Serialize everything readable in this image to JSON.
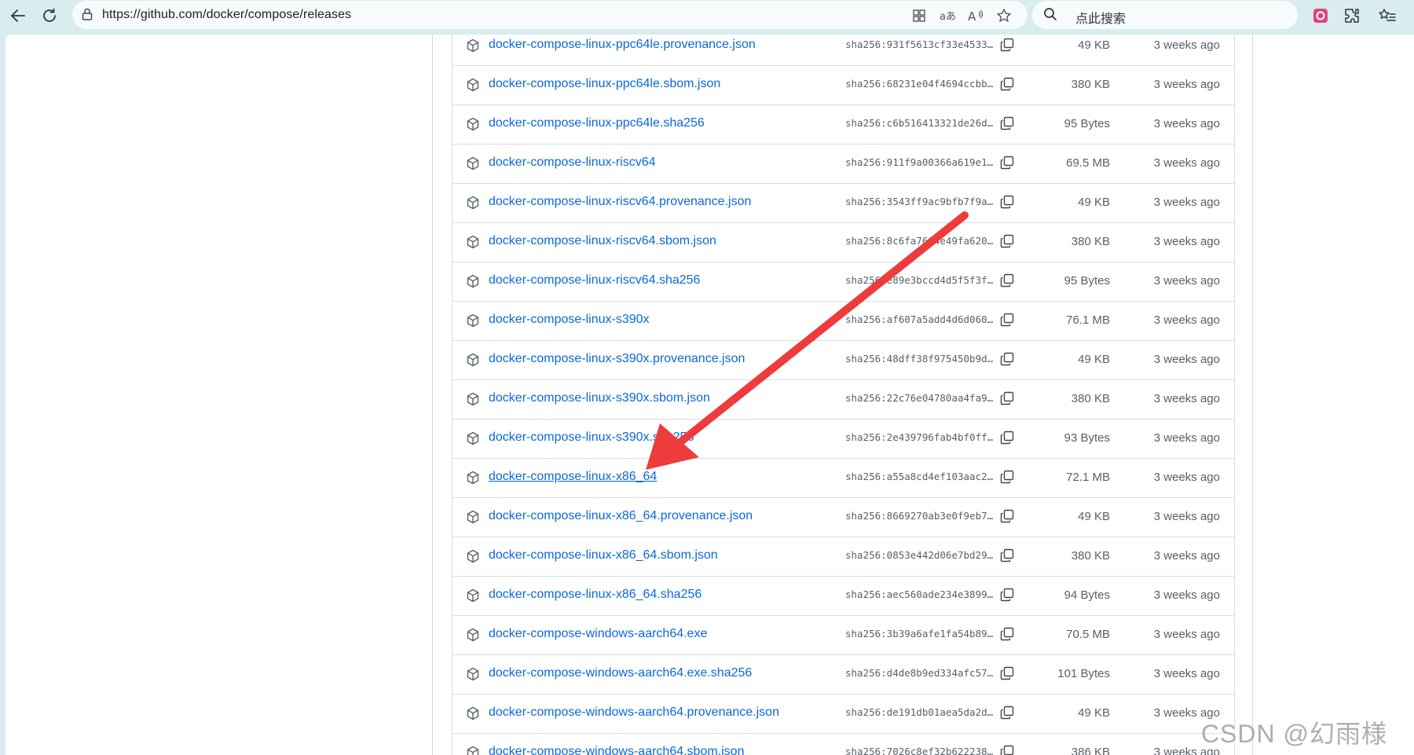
{
  "browser": {
    "url": "https://github.com/docker/compose/releases",
    "search_placeholder": "点此搜索"
  },
  "assets": [
    {
      "name": "docker-compose-linux-ppc64le.provenance.json",
      "sha": "sha256:931f5613cf33e4533…",
      "size": "49 KB",
      "date": "3 weeks ago"
    },
    {
      "name": "docker-compose-linux-ppc64le.sbom.json",
      "sha": "sha256:68231e04f4694ccbb…",
      "size": "380 KB",
      "date": "3 weeks ago"
    },
    {
      "name": "docker-compose-linux-ppc64le.sha256",
      "sha": "sha256:c6b516413321de26d…",
      "size": "95 Bytes",
      "date": "3 weeks ago"
    },
    {
      "name": "docker-compose-linux-riscv64",
      "sha": "sha256:911f9a00366a619e1…",
      "size": "69.5 MB",
      "date": "3 weeks ago"
    },
    {
      "name": "docker-compose-linux-riscv64.provenance.json",
      "sha": "sha256:3543ff9ac9bfb7f9a…",
      "size": "49 KB",
      "date": "3 weeks ago"
    },
    {
      "name": "docker-compose-linux-riscv64.sbom.json",
      "sha": "sha256:8c6fa7604e49fa620…",
      "size": "380 KB",
      "date": "3 weeks ago"
    },
    {
      "name": "docker-compose-linux-riscv64.sha256",
      "sha": "sha256:e89e3bccd4d5f5f3f…",
      "size": "95 Bytes",
      "date": "3 weeks ago"
    },
    {
      "name": "docker-compose-linux-s390x",
      "sha": "sha256:af607a5add4d6d060…",
      "size": "76.1 MB",
      "date": "3 weeks ago"
    },
    {
      "name": "docker-compose-linux-s390x.provenance.json",
      "sha": "sha256:48dff38f975450b9d…",
      "size": "49 KB",
      "date": "3 weeks ago"
    },
    {
      "name": "docker-compose-linux-s390x.sbom.json",
      "sha": "sha256:22c76e04780aa4fa9…",
      "size": "380 KB",
      "date": "3 weeks ago"
    },
    {
      "name": "docker-compose-linux-s390x.sha256",
      "sha": "sha256:2e439796fab4bf0ff…",
      "size": "93 Bytes",
      "date": "3 weeks ago"
    },
    {
      "name": "docker-compose-linux-x86_64",
      "sha": "sha256:a55a8cd4ef103aac2…",
      "size": "72.1 MB",
      "date": "3 weeks ago",
      "highlighted": true
    },
    {
      "name": "docker-compose-linux-x86_64.provenance.json",
      "sha": "sha256:8669270ab3e0f9eb7…",
      "size": "49 KB",
      "date": "3 weeks ago"
    },
    {
      "name": "docker-compose-linux-x86_64.sbom.json",
      "sha": "sha256:0853e442d06e7bd29…",
      "size": "380 KB",
      "date": "3 weeks ago"
    },
    {
      "name": "docker-compose-linux-x86_64.sha256",
      "sha": "sha256:aec560ade234e3899…",
      "size": "94 Bytes",
      "date": "3 weeks ago"
    },
    {
      "name": "docker-compose-windows-aarch64.exe",
      "sha": "sha256:3b39a6afe1fa54b89…",
      "size": "70.5 MB",
      "date": "3 weeks ago"
    },
    {
      "name": "docker-compose-windows-aarch64.exe.sha256",
      "sha": "sha256:d4de8b9ed334afc57…",
      "size": "101 Bytes",
      "date": "3 weeks ago"
    },
    {
      "name": "docker-compose-windows-aarch64.provenance.json",
      "sha": "sha256:de191db01aea5da2d…",
      "size": "49 KB",
      "date": "3 weeks ago"
    },
    {
      "name": "docker-compose-windows-aarch64.sbom.json",
      "sha": "sha256:7026c8ef32b622238…",
      "size": "386 KB",
      "date": "3 weeks ago"
    }
  ],
  "watermark": "CSDN @幻雨様",
  "colors": {
    "link": "#0969da",
    "annotation_arrow": "#ee3b3b",
    "toolbar_bg": "#d9ecef"
  }
}
